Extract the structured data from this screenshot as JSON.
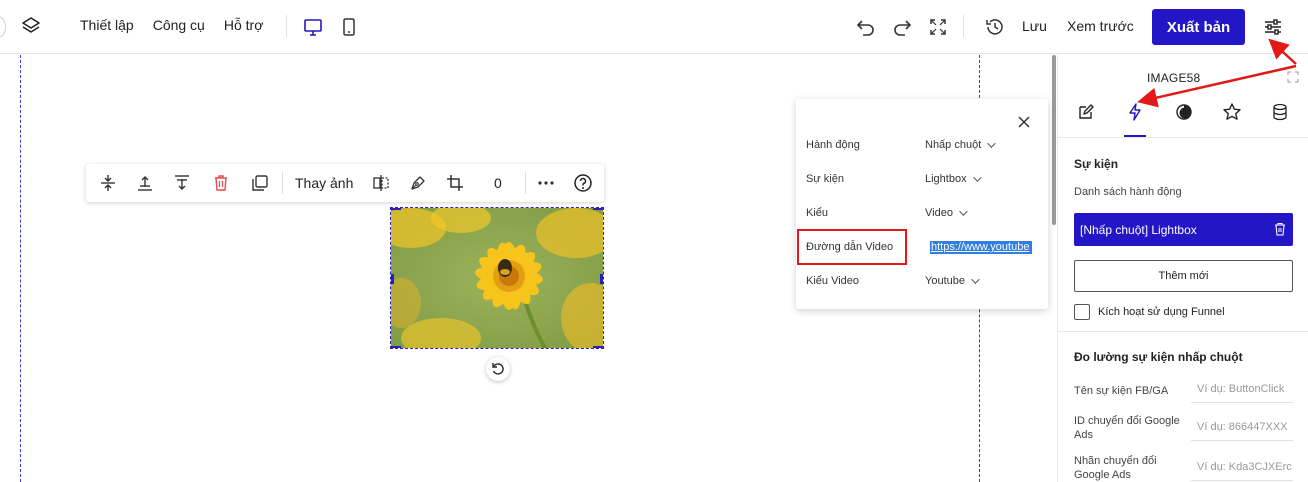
{
  "topbar": {
    "menu": [
      "Thiết lập",
      "Công cụ",
      "Hỗ trợ"
    ],
    "save_label": "Lưu",
    "preview_label": "Xem trước",
    "publish_label": "Xuất bản"
  },
  "toolbar": {
    "replace_image_label": "Thay ảnh",
    "rotation_value": "0"
  },
  "action_popup": {
    "rows": [
      {
        "label": "Hành động",
        "value": "Nhấp chuột"
      },
      {
        "label": "Sự kiện",
        "value": "Lightbox"
      },
      {
        "label": "Kiểu",
        "value": "Video"
      },
      {
        "label": "Đường dẫn Video",
        "value": "https://www.youtube"
      },
      {
        "label": "Kiểu Video",
        "value": "Youtube"
      }
    ]
  },
  "panel": {
    "title": "IMAGE58",
    "event_section_title": "Sự kiện",
    "action_list_label": "Danh sách hành động",
    "action_item_label": "[Nhấp chuột] Lightbox",
    "add_button_label": "Thêm mới",
    "funnel_checkbox_label": "Kích hoạt sử dụng Funnel",
    "tracking_section_title": "Đo lường sự kiện nhấp chuột",
    "fields": [
      {
        "label": "Tên sự kiện FB/GA",
        "placeholder": "Ví dụ: ButtonClick"
      },
      {
        "label": "ID chuyển đổi Google Ads",
        "placeholder": "Ví dụ: 866447XXX"
      },
      {
        "label": "Nhãn chuyển đổi Google Ads",
        "placeholder": "Ví dụ: Kda3CJXErc"
      }
    ]
  },
  "colors": {
    "primary": "#2316c7",
    "highlight": "#e31919",
    "link_selection": "#2f7ee0"
  }
}
